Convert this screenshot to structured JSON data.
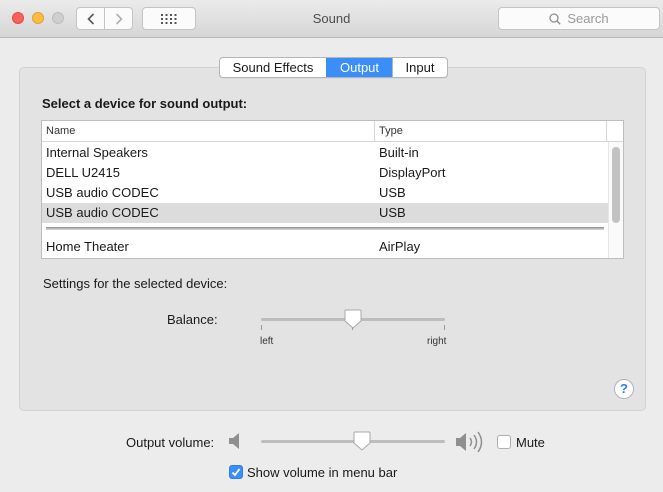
{
  "window": {
    "title": "Sound",
    "search_placeholder": "Search"
  },
  "tabs": [
    {
      "label": "Sound Effects",
      "active": false
    },
    {
      "label": "Output",
      "active": true
    },
    {
      "label": "Input",
      "active": false
    }
  ],
  "output": {
    "section_title": "Select a device for sound output:",
    "columns": {
      "name": "Name",
      "type": "Type"
    },
    "devices": [
      {
        "name": "Internal Speakers",
        "type": "Built-in",
        "selected": false
      },
      {
        "name": "DELL U2415",
        "type": "DisplayPort",
        "selected": false
      },
      {
        "name": "USB audio CODEC",
        "type": "USB",
        "selected": false
      },
      {
        "name": "USB audio CODEC",
        "type": "USB",
        "selected": true
      },
      {
        "name": "Home Theater",
        "type": "AirPlay",
        "selected": false
      }
    ],
    "settings_label": "Settings for the selected device:",
    "balance": {
      "label": "Balance:",
      "left": "left",
      "right": "right",
      "value_fraction": 0.5
    },
    "help": "?"
  },
  "volume": {
    "label": "Output volume:",
    "value_fraction": 0.55,
    "mute_label": "Mute",
    "mute_checked": false,
    "show_in_menu_bar_label": "Show volume in menu bar",
    "show_in_menu_bar_checked": true
  },
  "colors": {
    "accent": "#3a8ef7",
    "close": "#fc605c",
    "minimize": "#fdbc40",
    "zoom_disabled": "#cfcfcf"
  },
  "icons": [
    "back-chevron-icon",
    "forward-chevron-icon",
    "grid-icon",
    "search-icon",
    "speaker-low-icon",
    "speaker-high-icon",
    "checkmark-icon"
  ]
}
